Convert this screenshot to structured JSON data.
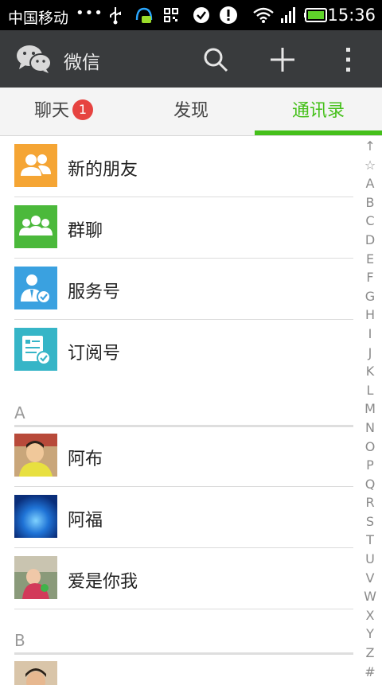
{
  "status_bar": {
    "carrier": "中国移动",
    "dots": "•••",
    "time": "15:36"
  },
  "app_bar": {
    "title": "微信"
  },
  "tabs": [
    {
      "label": "聊天",
      "badge": "1"
    },
    {
      "label": "发现"
    },
    {
      "label": "通讯录"
    }
  ],
  "fixed_items": [
    {
      "label": "新的朋友",
      "color": "#f5a534"
    },
    {
      "label": "群聊",
      "color": "#4bb93b"
    },
    {
      "label": "服务号",
      "color": "#3aa1e0"
    },
    {
      "label": "订阅号",
      "color": "#36b5c7"
    }
  ],
  "sections": [
    {
      "letter": "A",
      "contacts": [
        {
          "name": "阿布"
        },
        {
          "name": "阿福"
        },
        {
          "name": "爱是你我"
        }
      ]
    },
    {
      "letter": "B"
    }
  ],
  "alphabet_index": [
    "↑",
    "☆",
    "A",
    "B",
    "C",
    "D",
    "E",
    "F",
    "G",
    "H",
    "I",
    "J",
    "K",
    "L",
    "M",
    "N",
    "O",
    "P",
    "Q",
    "R",
    "S",
    "T",
    "U",
    "V",
    "W",
    "X",
    "Y",
    "Z",
    "#"
  ],
  "colors": {
    "accent": "#45c01a",
    "badge": "#e64340",
    "app_bar": "#393b3d"
  }
}
